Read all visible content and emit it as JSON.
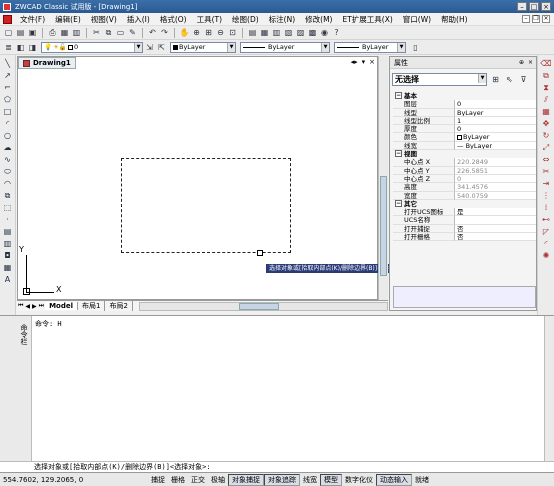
{
  "title": "ZWCAD Classic 试用版 - [Drawing1]",
  "menu": [
    "文件(F)",
    "编辑(E)",
    "视图(V)",
    "插入(I)",
    "格式(O)",
    "工具(T)",
    "绘图(D)",
    "标注(N)",
    "修改(M)",
    "ET扩展工具(X)",
    "窗口(W)",
    "帮助(H)"
  ],
  "toolbar2": {
    "layer_value": "0",
    "color_value": "ByLayer",
    "linetype_value": "ByLayer",
    "lineweight_value": "ByLayer"
  },
  "drawing": {
    "tab_label": "Drawing1",
    "axis_y": "Y",
    "axis_x": "X"
  },
  "tooltip": "选择对象或[拾取内部点(K)/删除边界(B)]<选择对象>:",
  "layout_tabs": [
    "Model",
    "布局1",
    "布局2"
  ],
  "properties": {
    "title": "属性",
    "selection": "无选择",
    "groups": [
      {
        "name": "基本",
        "rows": [
          [
            "图层",
            "0"
          ],
          [
            "线型",
            "ByLayer"
          ],
          [
            "线型比例",
            "1"
          ],
          [
            "厚度",
            "0"
          ],
          [
            "颜色",
            "ByLayer"
          ],
          [
            "线宽",
            "— ByLayer"
          ]
        ]
      },
      {
        "name": "视图",
        "rows": [
          [
            "中心点 X",
            "220.2849"
          ],
          [
            "中心点 Y",
            "226.5851"
          ],
          [
            "中心点 Z",
            "0"
          ],
          [
            "高度",
            "341.4576"
          ],
          [
            "宽度",
            "540.0759"
          ]
        ]
      },
      {
        "name": "其它",
        "rows": [
          [
            "打开UCS图标",
            "是"
          ],
          [
            "UCS名称",
            ""
          ],
          [
            "打开捕捉",
            "否"
          ],
          [
            "打开栅格",
            "否"
          ]
        ]
      }
    ]
  },
  "command": {
    "side_label": "命令栏",
    "history": "命令: H",
    "prompt": "选择对象或[拾取内部点(K)/删除边界(B)]<选择对象>:"
  },
  "status": {
    "coords": "554.7602,  129.2065,  0",
    "items": [
      "捕捉",
      "栅格",
      "正交",
      "极轴",
      "对象捕捉",
      "对象追踪",
      "线宽",
      "模型",
      "数字化仪",
      "动态输入",
      "就绪"
    ]
  },
  "icons": {
    "left": [
      "line-icon",
      "ray-icon",
      "polyline-icon",
      "polygon-icon",
      "rectangle-icon",
      "arc-icon",
      "circle-icon",
      "revcloud-icon",
      "spline-icon",
      "ellipse-icon",
      "ellipse-arc-icon",
      "insert-block-icon",
      "make-block-icon",
      "point-icon",
      "hatch-icon",
      "gradient-icon",
      "region-icon",
      "table-icon",
      "mtext-icon"
    ],
    "right": [
      "erase-icon",
      "copy-icon",
      "mirror-icon",
      "offset-icon",
      "array-icon",
      "move-icon",
      "rotate-icon",
      "scale-icon",
      "stretch-icon",
      "trim-icon",
      "extend-icon",
      "break-point-icon",
      "break-icon",
      "join-icon",
      "chamfer-icon",
      "fillet-icon",
      "explode-icon"
    ]
  }
}
